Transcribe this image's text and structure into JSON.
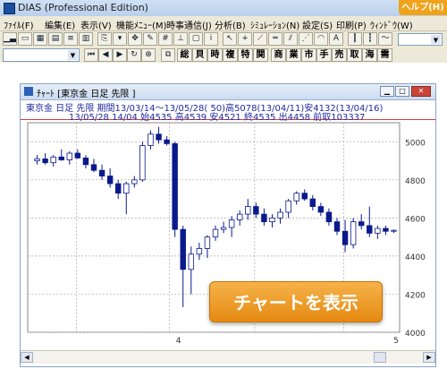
{
  "app": {
    "title": "DIAS (Professional Edition)",
    "help_label": "ヘルプ(H)"
  },
  "menu": [
    {
      "label": "ﾌｧｲﾙ(F)"
    },
    {
      "label": "編集(E)"
    },
    {
      "label": "表示(V)"
    },
    {
      "label": "機能ﾒﾆｭｰ(M)"
    },
    {
      "label": "時事通信(J)"
    },
    {
      "label": "分析(B)"
    },
    {
      "label": "ｼﾐｭﾚｰｼｮﾝ(N)"
    },
    {
      "label": "設定(S)"
    },
    {
      "label": "印刷(P)"
    },
    {
      "label": "ｳｨﾝﾄﾞｳ(W)"
    }
  ],
  "toolbar2": {
    "kanji_buttons": [
      "総",
      "貝",
      "時",
      "複",
      "特",
      "関",
      "商",
      "業",
      "市",
      "手",
      "売",
      "取",
      "海",
      "需"
    ]
  },
  "chart_window": {
    "title": "ﾁｬｰﾄ [東京金      日足 先限 ]",
    "info_line1": "東京金  日足 先限 期間13/03/14〜13/05/28( 50)高5078(13/04/11)安4132(13/04/16)",
    "info_line2": "13/05/28 14/04 始4535 高4539 安4521 終4535 出4458 前取103337"
  },
  "banner": {
    "label": "チャートを表示"
  },
  "colors": {
    "up": "#ffffff",
    "down": "#0a1a8c",
    "accent_banner": "#e58a12",
    "grid": "#aaaaaa"
  },
  "chart_data": {
    "type": "candlestick",
    "y_ticks": [
      "5000",
      "4800",
      "4600",
      "4400",
      "4200",
      "4000"
    ],
    "x_labels": [
      "4",
      "5"
    ],
    "ylim": [
      4000,
      5100
    ],
    "candles": [
      {
        "o": 4900,
        "h": 4930,
        "l": 4880,
        "c": 4910
      },
      {
        "o": 4910,
        "h": 4940,
        "l": 4880,
        "c": 4890
      },
      {
        "o": 4890,
        "h": 4930,
        "l": 4870,
        "c": 4920
      },
      {
        "o": 4920,
        "h": 4960,
        "l": 4900,
        "c": 4905
      },
      {
        "o": 4905,
        "h": 4950,
        "l": 4880,
        "c": 4940
      },
      {
        "o": 4940,
        "h": 4960,
        "l": 4910,
        "c": 4915
      },
      {
        "o": 4915,
        "h": 4930,
        "l": 4860,
        "c": 4880
      },
      {
        "o": 4880,
        "h": 4910,
        "l": 4840,
        "c": 4850
      },
      {
        "o": 4850,
        "h": 4880,
        "l": 4800,
        "c": 4820
      },
      {
        "o": 4820,
        "h": 4860,
        "l": 4760,
        "c": 4780
      },
      {
        "o": 4780,
        "h": 4800,
        "l": 4700,
        "c": 4730
      },
      {
        "o": 4730,
        "h": 4790,
        "l": 4620,
        "c": 4780
      },
      {
        "o": 4780,
        "h": 4820,
        "l": 4760,
        "c": 4800
      },
      {
        "o": 4800,
        "h": 5000,
        "l": 4790,
        "c": 4980
      },
      {
        "o": 4980,
        "h": 5060,
        "l": 4960,
        "c": 5040
      },
      {
        "o": 5040,
        "h": 5078,
        "l": 4990,
        "c": 5010
      },
      {
        "o": 5010,
        "h": 5030,
        "l": 4980,
        "c": 4990
      },
      {
        "o": 4990,
        "h": 5000,
        "l": 4500,
        "c": 4540
      },
      {
        "o": 4540,
        "h": 4560,
        "l": 4132,
        "c": 4330
      },
      {
        "o": 4330,
        "h": 4450,
        "l": 4200,
        "c": 4410
      },
      {
        "o": 4410,
        "h": 4470,
        "l": 4380,
        "c": 4440
      },
      {
        "o": 4440,
        "h": 4510,
        "l": 4390,
        "c": 4500
      },
      {
        "o": 4500,
        "h": 4560,
        "l": 4480,
        "c": 4540
      },
      {
        "o": 4540,
        "h": 4580,
        "l": 4520,
        "c": 4550
      },
      {
        "o": 4550,
        "h": 4610,
        "l": 4500,
        "c": 4590
      },
      {
        "o": 4590,
        "h": 4640,
        "l": 4560,
        "c": 4620
      },
      {
        "o": 4620,
        "h": 4700,
        "l": 4590,
        "c": 4660
      },
      {
        "o": 4660,
        "h": 4680,
        "l": 4600,
        "c": 4620
      },
      {
        "o": 4620,
        "h": 4650,
        "l": 4560,
        "c": 4580
      },
      {
        "o": 4580,
        "h": 4620,
        "l": 4550,
        "c": 4600
      },
      {
        "o": 4600,
        "h": 4650,
        "l": 4570,
        "c": 4630
      },
      {
        "o": 4630,
        "h": 4700,
        "l": 4600,
        "c": 4690
      },
      {
        "o": 4690,
        "h": 4740,
        "l": 4670,
        "c": 4730
      },
      {
        "o": 4730,
        "h": 4750,
        "l": 4690,
        "c": 4700
      },
      {
        "o": 4700,
        "h": 4720,
        "l": 4640,
        "c": 4660
      },
      {
        "o": 4660,
        "h": 4680,
        "l": 4610,
        "c": 4630
      },
      {
        "o": 4630,
        "h": 4650,
        "l": 4560,
        "c": 4580
      },
      {
        "o": 4580,
        "h": 4600,
        "l": 4510,
        "c": 4530
      },
      {
        "o": 4530,
        "h": 4590,
        "l": 4420,
        "c": 4460
      },
      {
        "o": 4460,
        "h": 4600,
        "l": 4440,
        "c": 4580
      },
      {
        "o": 4580,
        "h": 4620,
        "l": 4540,
        "c": 4560
      },
      {
        "o": 4560,
        "h": 4660,
        "l": 4500,
        "c": 4520
      },
      {
        "o": 4520,
        "h": 4560,
        "l": 4490,
        "c": 4545
      },
      {
        "o": 4545,
        "h": 4560,
        "l": 4510,
        "c": 4530
      },
      {
        "o": 4535,
        "h": 4539,
        "l": 4521,
        "c": 4535
      }
    ]
  }
}
